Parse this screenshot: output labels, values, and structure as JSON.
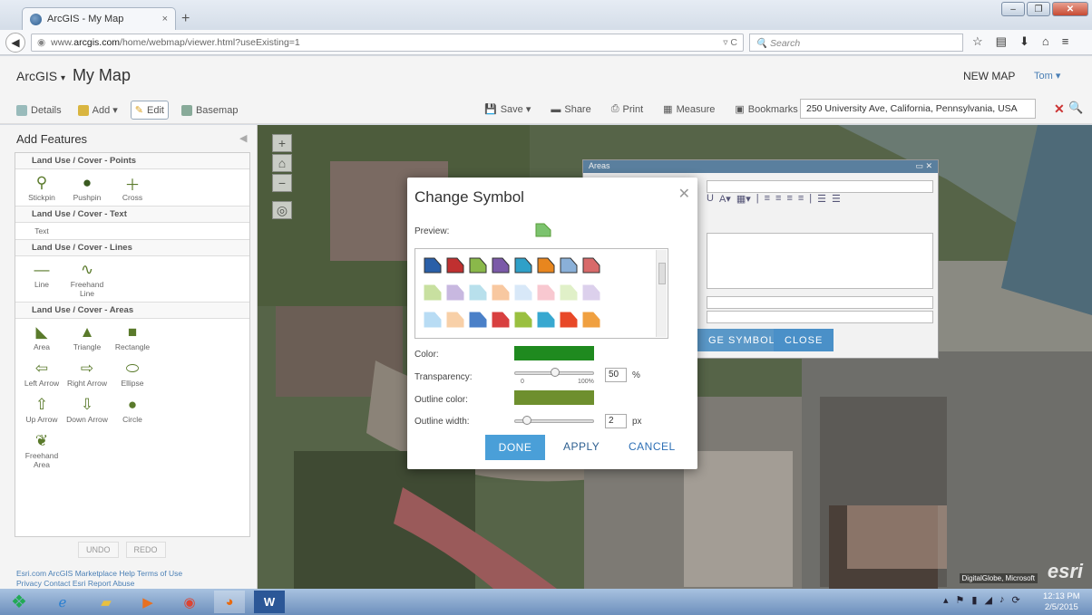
{
  "browser": {
    "tab_title": "ArcGIS - My Map",
    "tab_close": "×",
    "new_tab": "+",
    "url_prefix": "www.",
    "url_domain": "arcgis.com",
    "url_path": "/home/webmap/viewer.html?useExisting=1",
    "search_placeholder": "Search"
  },
  "app": {
    "brand": "ArcGIS",
    "brand_sep": "▾",
    "map_name": "My Map",
    "new_map": "NEW MAP",
    "user": "Tom ▾"
  },
  "toolbar": {
    "details": "Details",
    "add": "Add ▾",
    "edit": "Edit",
    "basemap": "Basemap",
    "save": "Save ▾",
    "share": "Share",
    "print": "Print",
    "measure": "Measure",
    "bookmarks": "Bookmarks",
    "address": "250 University Ave, California, Pennsylvania, USA"
  },
  "sidebar": {
    "title": "Add Features",
    "groups": [
      {
        "title": "Land Use / Cover - Points",
        "items": [
          "Stickpin",
          "Pushpin",
          "Cross"
        ]
      },
      {
        "title": "Land Use / Cover - Text",
        "items": [
          "Text"
        ]
      },
      {
        "title": "Land Use / Cover - Lines",
        "items": [
          "Line",
          "Freehand Line"
        ]
      },
      {
        "title": "Land Use / Cover - Areas",
        "items": [
          "Area",
          "Triangle",
          "Rectangle",
          "Left Arrow",
          "Right Arrow",
          "Ellipse",
          "Up Arrow",
          "Down Arrow",
          "Circle",
          "Freehand Area"
        ]
      }
    ],
    "undo": "UNDO",
    "redo": "REDO",
    "footer_line1": "Esri.com  ArcGIS Marketplace  Help  Terms of Use",
    "footer_line2": "Privacy  Contact Esri  Report Abuse"
  },
  "areas_popup": {
    "title": "Areas",
    "change_symbol_btn": "GE SYMBOL",
    "close_btn": "CLOSE"
  },
  "modal": {
    "title": "Change Symbol",
    "preview_label": "Preview:",
    "color_label": "Color:",
    "color_value": "#1f8a1f",
    "transparency_label": "Transparency:",
    "transparency_value": "50",
    "transparency_unit": "%",
    "tick_min": "0",
    "tick_max": "100%",
    "outline_color_label": "Outline color:",
    "outline_color_value": "#6e8f2e",
    "outline_width_label": "Outline width:",
    "outline_width_value": "2",
    "outline_width_unit": "px",
    "done": "DONE",
    "apply": "APPLY",
    "cancel": "CANCEL",
    "swatch_rows": [
      [
        "#2a5fa8",
        "#c03030",
        "#8ab84a",
        "#7b5aa8",
        "#2fa0c8",
        "#e8861e",
        "#8ab0d8",
        "#d86a6a"
      ],
      [
        "#c8e0a0",
        "#c8b8e0",
        "#b8e0ec",
        "#f8c8a0",
        "#d8e8f8",
        "#f8c8d0",
        "#e0f0c8",
        "#dcd0ec"
      ],
      [
        "#b8dcf4",
        "#f8d0a8",
        "#4a80c8",
        "#d84040",
        "#9ac040",
        "#38a8d0",
        "#e84828",
        "#f0a040"
      ]
    ]
  },
  "map": {
    "credit": "DigitalGlobe, Microsoft",
    "logo": "esri"
  },
  "taskbar": {
    "time": "12:13 PM",
    "date": "2/5/2015"
  }
}
